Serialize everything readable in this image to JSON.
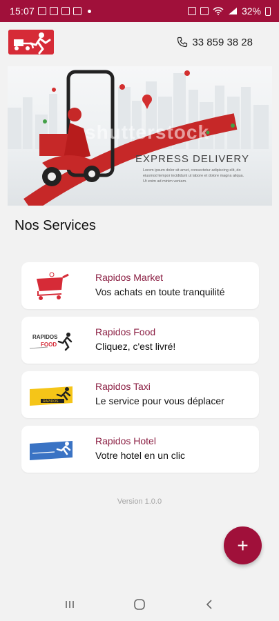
{
  "status_bar": {
    "time": "15:07",
    "battery": "32%"
  },
  "header": {
    "phone_number": "33 859 38 28"
  },
  "banner": {
    "title": "EXPRESS DELIVERY",
    "lorem": "Lorem ipsum dolor sit amet, consectetur adipiscing elit, do eiusmod tempor incididunt ut labore et dolore magna aliqua. Ut enim ad minim veniam."
  },
  "section_title": "Nos Services",
  "services": [
    {
      "title": "Rapidos Market",
      "subtitle": "Vos achats en toute tranquilité",
      "icon": "shopping-cart-icon"
    },
    {
      "title": "Rapidos Food",
      "subtitle": "Cliquez, c'est livré!",
      "icon": "food-delivery-logo"
    },
    {
      "title": "Rapidos Taxi",
      "subtitle": "Le service pour vous déplacer",
      "icon": "taxi-logo"
    },
    {
      "title": "Rapidos Hotel",
      "subtitle": "Votre hotel en un clic",
      "icon": "hotel-logo"
    }
  ],
  "version": "Version 1.0.0",
  "fab": {
    "label": "+"
  },
  "colors": {
    "brand": "#a0103a",
    "accent_title": "#8b1f43",
    "logo_red": "#d62b37"
  }
}
